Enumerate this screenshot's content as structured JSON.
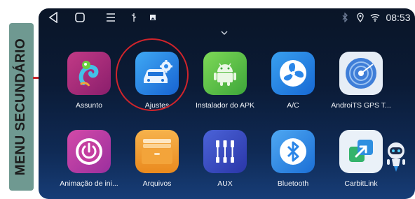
{
  "side_label": "MENU SECUNDÁRIO",
  "status_bar": {
    "icons": [
      "back-icon",
      "home-icon",
      "menu-icon",
      "usb-icon",
      "image-icon",
      "bluetooth-icon",
      "location-icon",
      "wifi-icon"
    ],
    "time": "08:53"
  },
  "apps": [
    {
      "label": "Assunto",
      "icon": "chameleon-icon"
    },
    {
      "label": "Ajustes",
      "icon": "car-settings-icon"
    },
    {
      "label": "Instalador do APK",
      "icon": "android-icon"
    },
    {
      "label": "A/C",
      "icon": "fan-icon"
    },
    {
      "label": "AndroiTS GPS T...",
      "icon": "gps-radar-icon"
    },
    {
      "label": "Animação de ini...",
      "icon": "power-icon"
    },
    {
      "label": "Arquivos",
      "icon": "folder-icon"
    },
    {
      "label": "AUX",
      "icon": "aux-icon"
    },
    {
      "label": "Bluetooth",
      "icon": "bluetooth-icon"
    },
    {
      "label": "CarbitLink",
      "icon": "carbitlink-icon"
    }
  ],
  "colors": {
    "highlight": "#d0242b",
    "side_label_bg": "#6f9991"
  }
}
